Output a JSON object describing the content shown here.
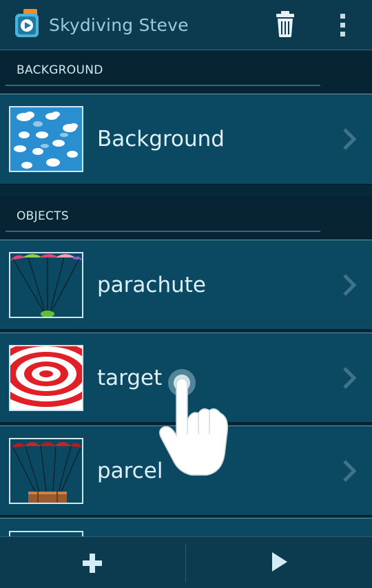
{
  "app": {
    "title": "Skydiving Steve",
    "icons": {
      "app": "app-icon",
      "delete": "trash-icon",
      "menu": "overflow-menu-icon"
    }
  },
  "sections": {
    "background": {
      "title": "BACKGROUND"
    },
    "objects": {
      "title": "OBJECTS"
    }
  },
  "background_item": {
    "label": "Background",
    "thumbnail": "clouds-sky-thumbnail"
  },
  "objects": [
    {
      "label": "parachute",
      "thumbnail": "parachute-thumbnail"
    },
    {
      "label": "target",
      "thumbnail": "target-thumbnail"
    },
    {
      "label": "parcel",
      "thumbnail": "parcel-thumbnail"
    }
  ],
  "bottom_bar": {
    "add": "plus-icon",
    "play": "play-icon"
  },
  "colors": {
    "action_bar": "#0c3a4f",
    "list_item": "#0b4962",
    "section_bg": "#062433",
    "text": "#ddf0f8"
  }
}
